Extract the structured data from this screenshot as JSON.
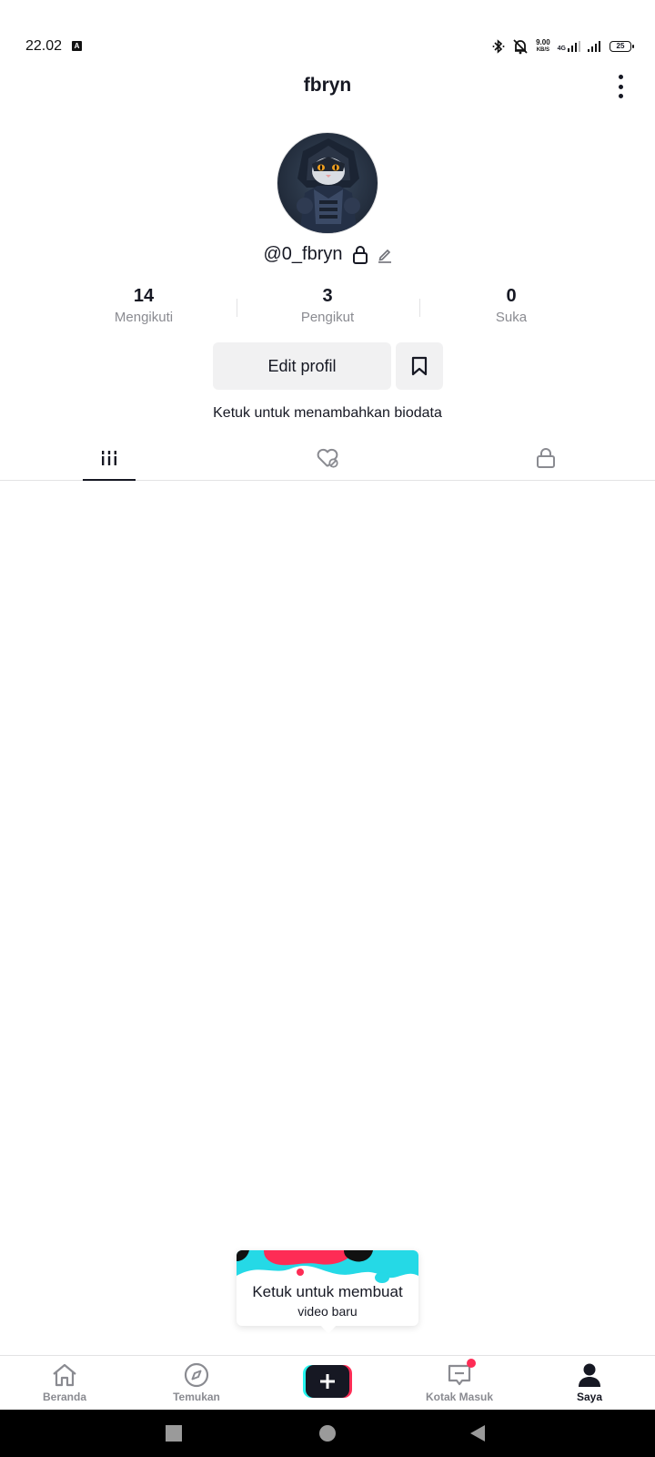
{
  "status_bar": {
    "time": "22.02",
    "app_badge": "A",
    "net_speed_value": "9.00",
    "net_speed_unit": "KB/S",
    "network_type": "4G",
    "battery": "25"
  },
  "header": {
    "title": "fbryn"
  },
  "profile": {
    "username": "@0_fbryn",
    "stats": [
      {
        "value": "14",
        "label": "Mengikuti"
      },
      {
        "value": "3",
        "label": "Pengikut"
      },
      {
        "value": "0",
        "label": "Suka"
      }
    ],
    "edit_button_label": "Edit profil",
    "bio_hint": "Ketuk untuk menambahkan biodata"
  },
  "tabs": {
    "active_index": 0,
    "items": [
      "videos-grid-icon",
      "liked-hidden-icon",
      "lock-icon"
    ]
  },
  "create_tooltip": {
    "title": "Ketuk untuk membuat",
    "subtitle": "video baru"
  },
  "bottom_nav": {
    "items": [
      {
        "label": "Beranda",
        "icon": "home-icon"
      },
      {
        "label": "Temukan",
        "icon": "compass-icon"
      },
      {
        "label": "",
        "icon": "plus-icon"
      },
      {
        "label": "Kotak Masuk",
        "icon": "inbox-icon"
      },
      {
        "label": "Saya",
        "icon": "profile-icon"
      }
    ],
    "active": "Saya"
  },
  "colors": {
    "accent_red": "#fe2c55",
    "accent_cyan": "#25f4ee",
    "text_primary": "#161823",
    "text_secondary": "#8a8b91"
  }
}
